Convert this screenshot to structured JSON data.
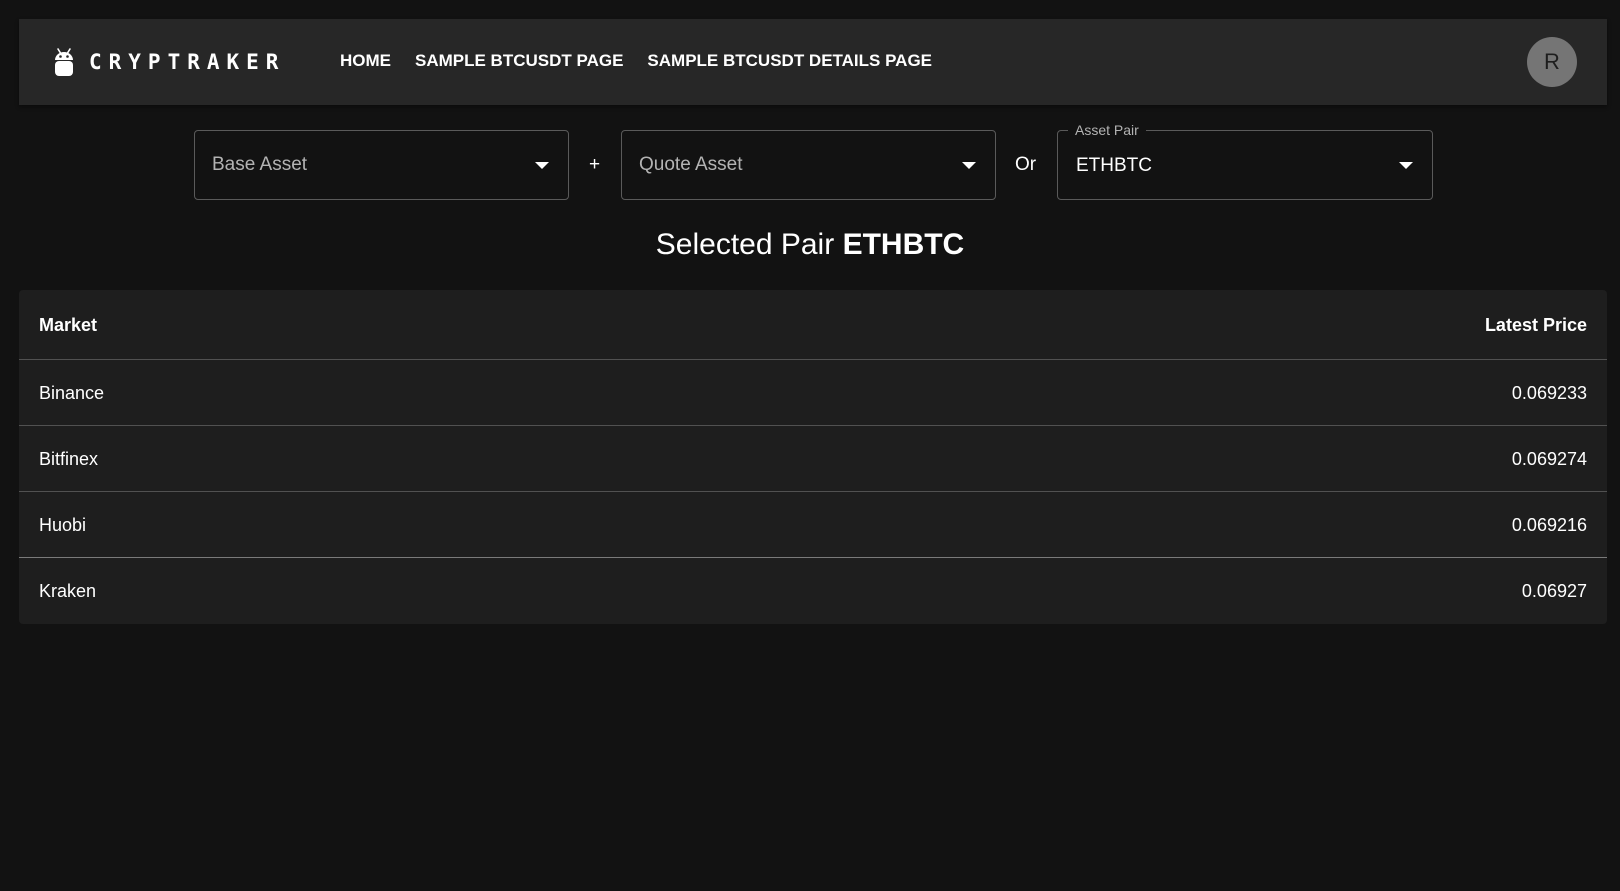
{
  "header": {
    "brand": "CRYPTRAKER",
    "logo_icon": "android-robot-icon",
    "nav": [
      {
        "label": "HOME"
      },
      {
        "label": "SAMPLE BTCUSDT PAGE"
      },
      {
        "label": "SAMPLE BTCUSDT DETAILS PAGE"
      }
    ],
    "avatar_initial": "R"
  },
  "selectors": {
    "base_asset": {
      "placeholder": "Base Asset",
      "value": ""
    },
    "plus_label": "+",
    "quote_asset": {
      "placeholder": "Quote Asset",
      "value": ""
    },
    "or_label": "Or",
    "asset_pair": {
      "label": "Asset Pair",
      "value": "ETHBTC"
    }
  },
  "selected": {
    "prefix": "Selected Pair",
    "pair": "ETHBTC"
  },
  "table": {
    "columns": [
      "Market",
      "Latest Price"
    ],
    "rows": [
      {
        "market": "Binance",
        "price": "0.069233"
      },
      {
        "market": "Bitfinex",
        "price": "0.069274"
      },
      {
        "market": "Huobi",
        "price": "0.069216"
      },
      {
        "market": "Kraken",
        "price": "0.06927"
      }
    ]
  },
  "colors": {
    "background": "#121212",
    "appbar": "#272727",
    "table_bg": "#1e1e1e",
    "avatar": "#757575"
  }
}
